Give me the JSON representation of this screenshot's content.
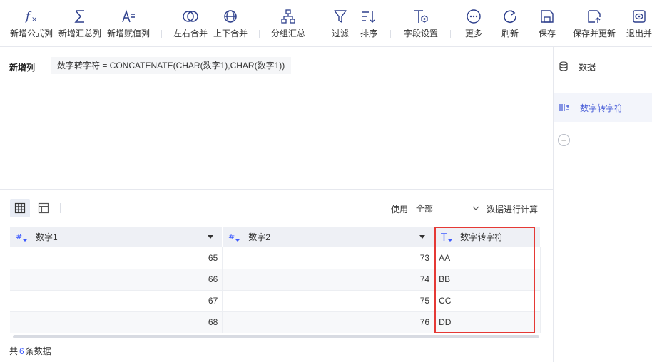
{
  "toolbar": {
    "items": [
      {
        "label": "新增公式列",
        "icon": "fx-icon"
      },
      {
        "label": "新增汇总列",
        "icon": "sigma-icon"
      },
      {
        "label": "新增赋值列",
        "icon": "assign-icon"
      },
      {
        "label": "左右合并",
        "icon": "merge-horizontal-icon"
      },
      {
        "label": "上下合并",
        "icon": "merge-vertical-icon"
      },
      {
        "label": "分组汇总",
        "icon": "group-summary-icon"
      },
      {
        "label": "过滤",
        "icon": "filter-icon"
      },
      {
        "label": "排序",
        "icon": "sort-icon"
      },
      {
        "label": "字段设置",
        "icon": "field-settings-icon"
      },
      {
        "label": "更多",
        "icon": "more-icon"
      },
      {
        "label": "刷新",
        "icon": "refresh-icon"
      },
      {
        "label": "保存",
        "icon": "save-icon"
      },
      {
        "label": "保存并更新",
        "icon": "save-update-icon"
      },
      {
        "label": "退出并",
        "icon": "exit-preview-icon"
      }
    ]
  },
  "editor": {
    "label": "新增列",
    "formula": "数字转字符 = CONCATENATE(CHAR(数字1),CHAR(数字1))"
  },
  "controls": {
    "use_label": "使用",
    "scope_value": "全部",
    "calc_label": "数据进行计算"
  },
  "table": {
    "columns": [
      {
        "name": "数字1",
        "type": "number"
      },
      {
        "name": "数字2",
        "type": "number"
      },
      {
        "name": "数字转字符",
        "type": "text"
      }
    ],
    "rows": [
      [
        "65",
        "73",
        "AA"
      ],
      [
        "66",
        "74",
        "BB"
      ],
      [
        "67",
        "75",
        "CC"
      ],
      [
        "68",
        "76",
        "DD"
      ]
    ]
  },
  "footer": {
    "prefix": "共",
    "count": "6",
    "suffix": "条数据"
  },
  "sidebar": {
    "items": [
      {
        "label": "数据",
        "icon": "database-icon"
      },
      {
        "label": "数字转字符",
        "icon": "column-icon"
      }
    ]
  },
  "colors": {
    "accent": "#4a5fd8",
    "toolbar_icon": "#2d3f8c",
    "highlight": "#e53935",
    "header_bg": "#eef0f5"
  }
}
